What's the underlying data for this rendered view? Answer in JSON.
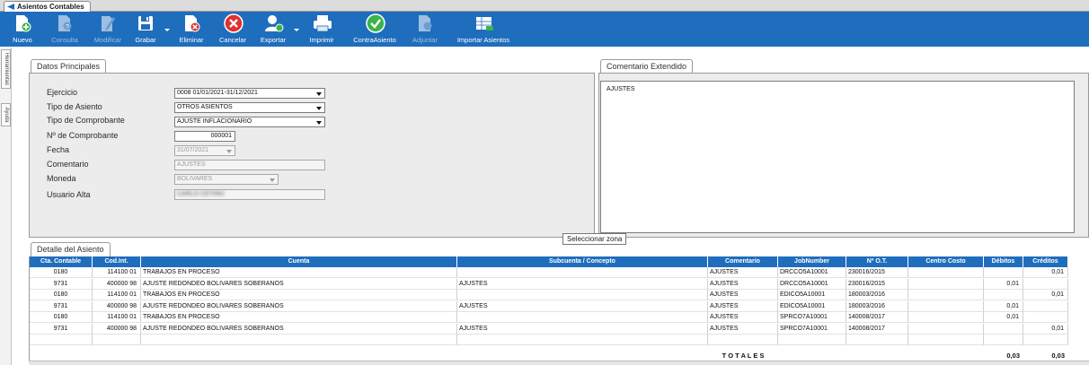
{
  "window": {
    "title": "Asientos Contables",
    "icon": "app-arrow-icon"
  },
  "toolbar": [
    {
      "id": "nuevo",
      "label": "Nuevo",
      "icon": "new-document-icon",
      "enabled": true
    },
    {
      "id": "consulta",
      "label": "Consulta",
      "icon": "query-document-icon",
      "enabled": false
    },
    {
      "id": "modificar",
      "label": "Modificar",
      "icon": "edit-pencil-icon",
      "enabled": false
    },
    {
      "id": "grabar",
      "label": "Grabar",
      "icon": "save-disk-icon",
      "enabled": true,
      "dropdown": true
    },
    {
      "id": "eliminar",
      "label": "Eliminar",
      "icon": "delete-document-icon",
      "enabled": true
    },
    {
      "id": "cancelar",
      "label": "Cancelar",
      "icon": "cancel-x-icon",
      "enabled": true
    },
    {
      "id": "exportar",
      "label": "Exportar",
      "icon": "export-user-icon",
      "enabled": true,
      "dropdown": true
    },
    {
      "id": "imprimir",
      "label": "Imprimir",
      "icon": "printer-icon",
      "enabled": true
    },
    {
      "id": "contraasiento",
      "label": "ContraAsiento",
      "icon": "check-circle-icon",
      "enabled": true
    },
    {
      "id": "adjuntar",
      "label": "Adjuntar",
      "icon": "attach-icon",
      "enabled": false
    },
    {
      "id": "importar",
      "label": "Importar Asientos",
      "icon": "import-table-icon",
      "enabled": true
    }
  ],
  "sidebar": {
    "tabs": [
      "Herramientas",
      "Ayuda"
    ]
  },
  "datos": {
    "tab_label": "Datos Principales",
    "ejercicio": {
      "label": "Ejercicio",
      "value": "0008 01/01/2021-31/12/2021"
    },
    "tipo_asiento": {
      "label": "Tipo de Asiento",
      "value": "OTROS ASIENTOS"
    },
    "tipo_comprobante": {
      "label": "Tipo de Comprobante",
      "value": "AJUSTE INFLACIONARIO"
    },
    "nro_comprobante": {
      "label": "Nº de Comprobante",
      "value": "000001"
    },
    "fecha": {
      "label": "Fecha",
      "value": "31/07/2021"
    },
    "comentario": {
      "label": "Comentario",
      "value": "AJUSTES"
    },
    "moneda": {
      "label": "Moneda",
      "value": "BOLIVARES"
    },
    "usuario_alta": {
      "label": "Usuario Alta",
      "value": "CARLO CETINO"
    }
  },
  "comentario_ext": {
    "tab_label": "Comentario Extendido",
    "value": "AJUSTES"
  },
  "tooltip": "Seleccionar zona",
  "detalle": {
    "tab_label": "Detalle del Asiento",
    "columns": [
      "Cta. Contable",
      "Cod.Int.",
      "Cuenta",
      "Subcuenta / Concepto",
      "Comentario",
      "JobNumber",
      "Nº O.T.",
      "Centro Costo",
      "Débitos",
      "Créditos"
    ],
    "rows": [
      [
        "0180",
        "114100 01",
        "TRABAJOS EN PROCESO",
        "",
        "AJUSTES",
        "DRCCO5A10001",
        "230016/2015",
        "",
        "",
        "0,01"
      ],
      [
        "9731",
        "400000 98",
        "AJUSTE REDONDEO BOLIVARES SOBERANOS",
        "AJUSTES",
        "AJUSTES",
        "DRCCO5A10001",
        "230016/2015",
        "",
        "0,01",
        ""
      ],
      [
        "0180",
        "114100 01",
        "TRABAJOS EN PROCESO",
        "",
        "AJUSTES",
        "EDICO5A10001",
        "180003/2016",
        "",
        "",
        "0,01"
      ],
      [
        "9731",
        "400000 98",
        "AJUSTE REDONDEO BOLIVARES SOBERANOS",
        "AJUSTES",
        "AJUSTES",
        "EDICO5A10001",
        "180003/2016",
        "",
        "0,01",
        ""
      ],
      [
        "0180",
        "114100 01",
        "TRABAJOS EN PROCESO",
        "",
        "AJUSTES",
        "SPRCO7A10001",
        "140008/2017",
        "",
        "0,01",
        ""
      ],
      [
        "9731",
        "400000 98",
        "AJUSTE REDONDEO BOLIVARES SOBERANOS",
        "AJUSTES",
        "AJUSTES",
        "SPRCO7A10001",
        "140008/2017",
        "",
        "",
        "0,01"
      ]
    ],
    "totals": {
      "label": "T O T A L E S",
      "debitos": "0,03",
      "creditos": "0,03"
    }
  },
  "colors": {
    "toolbar": "#1f6ebd",
    "header": "#1f6ebd",
    "panel": "#ececec"
  }
}
